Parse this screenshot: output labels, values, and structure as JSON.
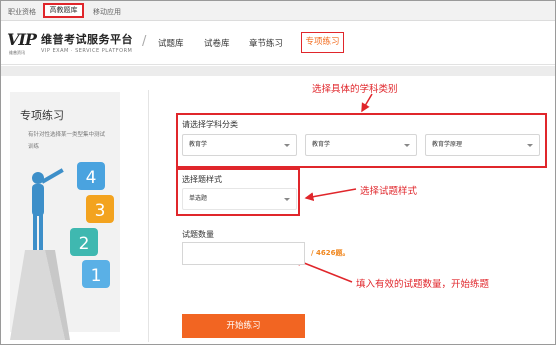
{
  "topnav": {
    "items": [
      "职业资格",
      "高教题库",
      "移动应用"
    ]
  },
  "header": {
    "logo_mark": "VIP",
    "logo_sub": "维普资讯",
    "site_title": "维普考试服务平台",
    "site_subtitle": "VIP EXAM · SERVICE PLATFORM",
    "tabs": [
      "试题库",
      "试卷库",
      "章节练习",
      "专项练习"
    ],
    "active_tab": "专项练习"
  },
  "left": {
    "title": "专项练习",
    "description": "有针对性选择某一类型集中测试训练",
    "blocks": [
      "4",
      "3",
      "2",
      "1"
    ]
  },
  "form": {
    "subject_label": "请选择学科分类",
    "subject_selects": [
      "教育学",
      "教育学",
      "教育学原理"
    ],
    "type_label": "选择题样式",
    "type_select": "单选题",
    "count_label": "试题数量",
    "count_value": "",
    "count_total": "/ 4626题。",
    "start_button": "开始练习"
  },
  "annotations": {
    "subject": "选择具体的学科类别",
    "type": "选择试题样式",
    "count": "填入有效的试题数量，开始练题"
  },
  "colors": {
    "accent": "#f26522",
    "highlight": "#e0262b",
    "block_4": "#4aa3df",
    "block_3": "#f3a31f",
    "block_2": "#3fb8b0",
    "block_1": "#5ab0e6"
  }
}
